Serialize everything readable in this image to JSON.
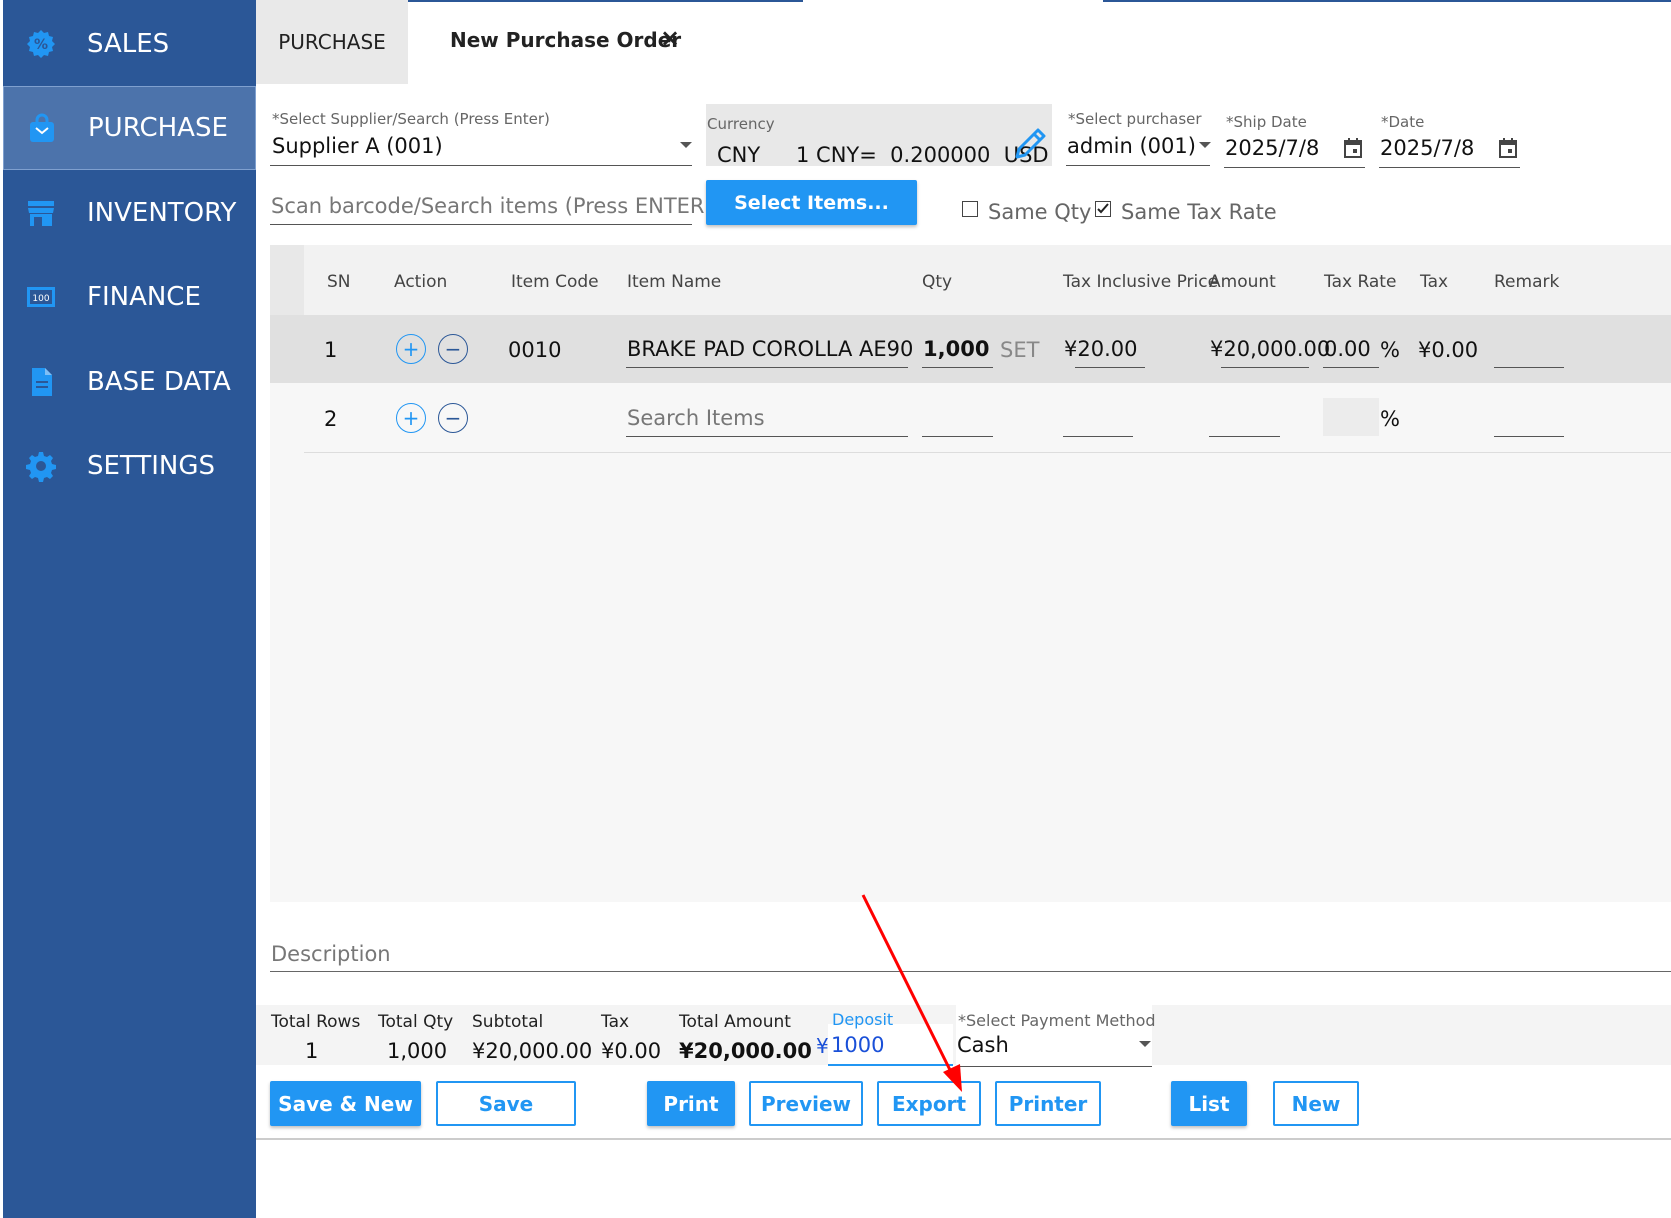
{
  "sidebar": {
    "items": [
      {
        "label": "SALES",
        "icon": "percent-gear-icon"
      },
      {
        "label": "PURCHASE",
        "icon": "shopping-bag-icon",
        "active": true
      },
      {
        "label": "INVENTORY",
        "icon": "store-icon"
      },
      {
        "label": "FINANCE",
        "icon": "banknote-icon"
      },
      {
        "label": "BASE DATA",
        "icon": "document-icon"
      },
      {
        "label": "SETTINGS",
        "icon": "gear-icon"
      }
    ]
  },
  "tabs": {
    "purchase": "PURCHASE",
    "new_order": "New Purchase Order",
    "close": "×"
  },
  "form": {
    "supplier_label": "*Select Supplier/Search (Press Enter)",
    "supplier_value": "Supplier A (001)",
    "currency_label": "Currency",
    "currency_code": "CNY",
    "exchange_rate": "1 CNY=  0.200000  USD",
    "purchaser_label": "*Select purchaser",
    "purchaser_value": "admin (001)",
    "ship_date_label": "*Ship Date",
    "ship_date_value": "2025/7/8",
    "date_label": "*Date",
    "date_value": "2025/7/8",
    "scan_placeholder": "Scan barcode/Search items (Press ENTER)",
    "select_items_button": "Select Items...",
    "same_qty_label": "Same Qty",
    "same_tax_rate_label": "Same Tax Rate",
    "same_tax_checked": true
  },
  "table": {
    "headers": [
      "SN",
      "Action",
      "Item Code",
      "Item Name",
      "Qty",
      "Tax Inclusive Price",
      "Amount",
      "Tax Rate",
      "Tax",
      "Remark"
    ],
    "rows": [
      {
        "sn": "1",
        "code": "0010",
        "name": "BRAKE PAD COROLLA AE90",
        "qty": "1,000",
        "unit": "SET",
        "price": "¥20.00",
        "amount": "¥20,000.00",
        "tax_rate": "0.00",
        "pct": "%",
        "tax": "¥0.00"
      },
      {
        "sn": "2",
        "name_placeholder": "Search Items",
        "pct": "%"
      }
    ],
    "plus": "+",
    "minus": "−"
  },
  "description_placeholder": "Description",
  "footer": {
    "total_rows_label": "Total Rows",
    "total_rows": "1",
    "total_qty_label": "Total Qty",
    "total_qty": "1,000",
    "subtotal_label": "Subtotal",
    "subtotal": "¥20,000.00",
    "tax_label": "Tax",
    "tax": "¥0.00",
    "total_amount_label": "Total Amount",
    "total_amount": "¥20,000.00",
    "deposit_label": "Deposit",
    "deposit_currency": "¥",
    "deposit_value": "1000",
    "payment_label": "*Select Payment Method",
    "payment_value": "Cash"
  },
  "buttons": {
    "save_new": "Save & New",
    "save": "Save",
    "print": "Print",
    "preview": "Preview",
    "export": "Export",
    "printer": "Printer",
    "list": "List",
    "new": "New"
  },
  "colors": {
    "sidebar": "#2b5797",
    "accent": "#2196f3",
    "annotation_arrow": "#ff0000"
  }
}
